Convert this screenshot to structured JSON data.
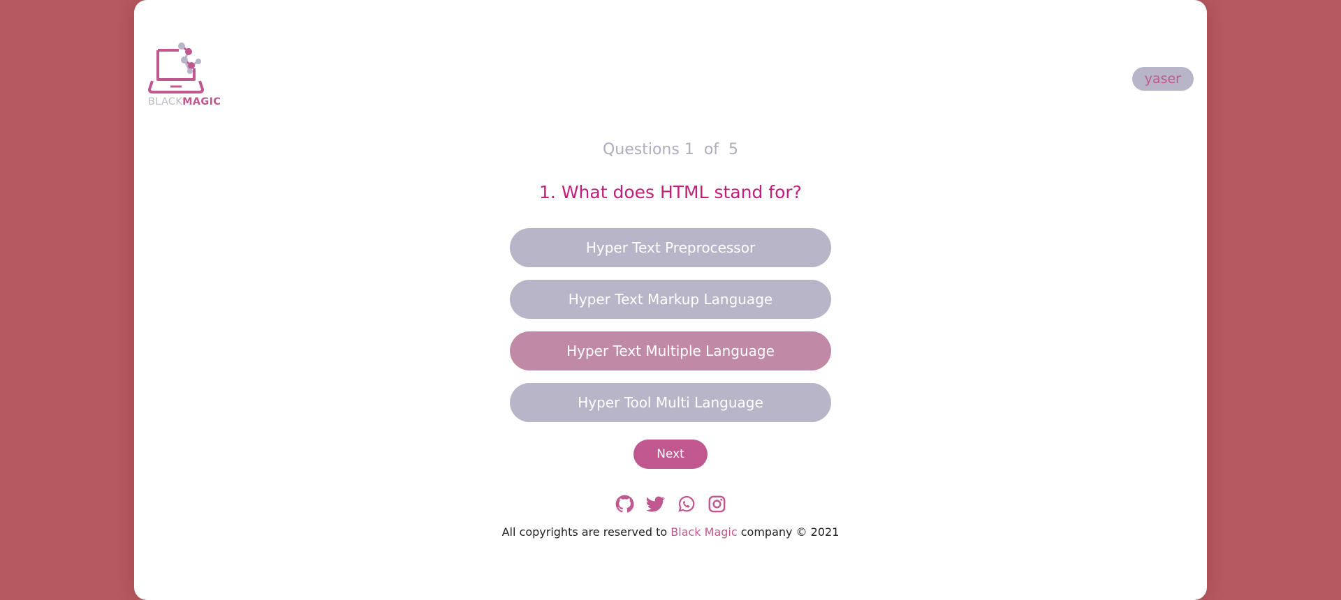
{
  "logo": {
    "word_light": "BLACK",
    "word_bold": "MAGIC"
  },
  "user": {
    "name": "yaser"
  },
  "quiz": {
    "counter_prefix": "Questions",
    "current": "1",
    "of_label": "of",
    "total": "5",
    "question": "1. What does HTML stand for?",
    "options": [
      {
        "label": "Hyper Text Preprocessor",
        "selected": false
      },
      {
        "label": "Hyper Text Markup Language",
        "selected": false
      },
      {
        "label": "Hyper Text Multiple Language",
        "selected": true
      },
      {
        "label": "Hyper Tool Multi Language",
        "selected": false
      }
    ],
    "next_label": "Next"
  },
  "social_icons": [
    "github-icon",
    "twitter-icon",
    "whatsapp-icon",
    "instagram-icon"
  ],
  "footer": {
    "prefix": "All copyrights are reserved to",
    "brand": "Black Magic",
    "suffix": "company © 2021"
  },
  "colors": {
    "background": "#b75a5f",
    "accent": "#c0588f",
    "question": "#c21d78",
    "option": "#b8b5c8",
    "option_selected": "#c08aa6"
  }
}
